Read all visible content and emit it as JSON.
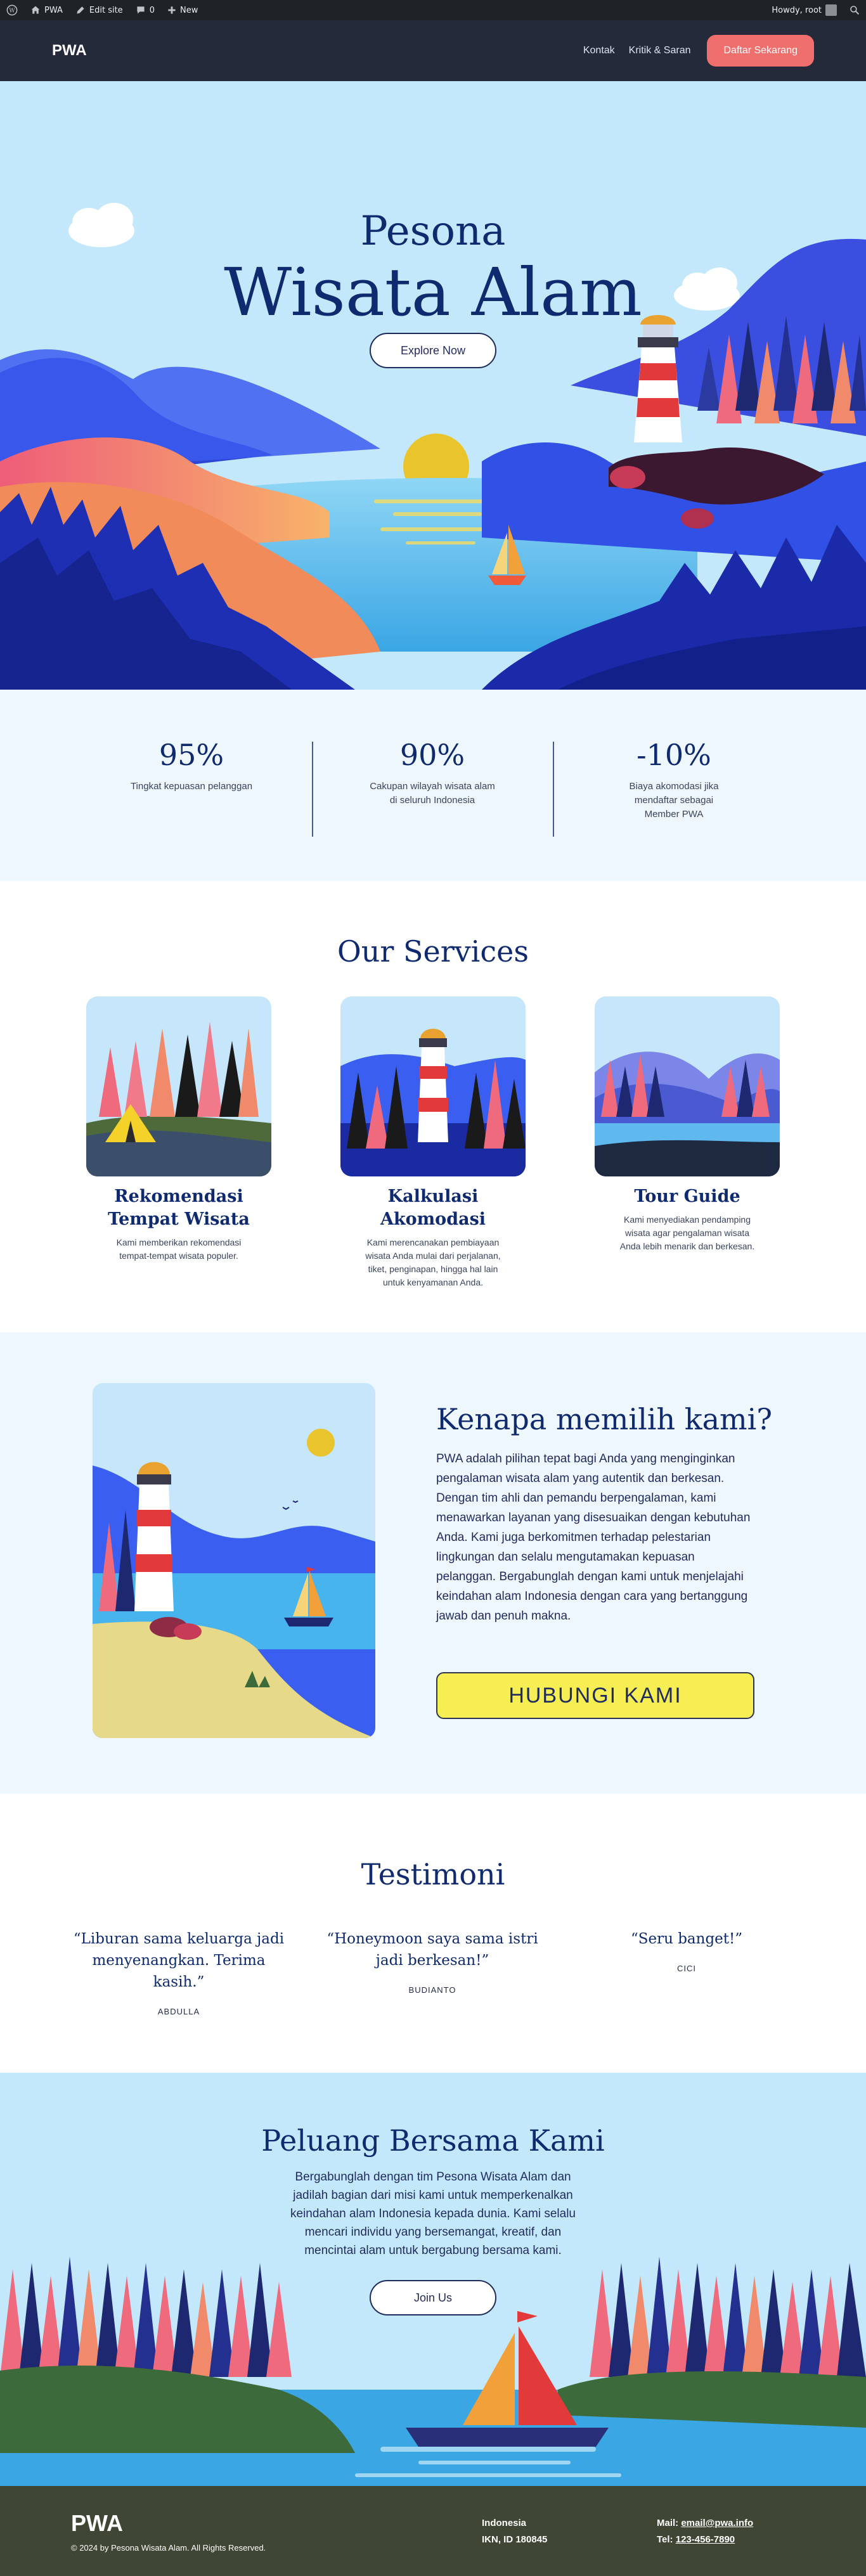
{
  "adminbar": {
    "site_name": "PWA",
    "edit_site": "Edit site",
    "comments_count": "0",
    "new_label": "New",
    "howdy": "Howdy, root"
  },
  "header": {
    "logo": "PWA",
    "nav": [
      "Kontak",
      "Kritik & Saran"
    ],
    "cta": "Daftar Sekarang"
  },
  "hero": {
    "kicker": "Pesona",
    "title": "Wisata Alam",
    "button": "Explore Now"
  },
  "stats": [
    {
      "value": "95%",
      "label": "Tingkat kepuasan pelanggan"
    },
    {
      "value": "90%",
      "label": "Cakupan wilayah wisata alam di seluruh Indonesia"
    },
    {
      "value": "-10%",
      "label": "Biaya akomodasi jika mendaftar sebagai Member PWA"
    }
  ],
  "services": {
    "title": "Our Services",
    "items": [
      {
        "title": "Rekomendasi Tempat Wisata",
        "desc": "Kami memberikan rekomendasi tempat-tempat wisata populer."
      },
      {
        "title": "Kalkulasi Akomodasi",
        "desc": "Kami merencanakan pembiayaan wisata Anda mulai dari perjalanan, tiket, penginapan, hingga hal lain untuk kenyamanan Anda."
      },
      {
        "title": "Tour Guide",
        "desc": "Kami menyediakan pendamping wisata agar pengalaman wisata Anda lebih menarik dan berkesan."
      }
    ]
  },
  "why": {
    "title": "Kenapa memilih kami?",
    "body": "PWA adalah pilihan tepat bagi Anda yang menginginkan pengalaman wisata alam yang autentik dan berkesan. Dengan tim ahli dan pemandu berpengalaman, kami menawarkan layanan yang disesuaikan dengan kebutuhan Anda. Kami juga berkomitmen terhadap pelestarian lingkungan dan selalu mengutamakan kepuasan pelanggan. Bergabunglah dengan kami untuk menjelajahi keindahan alam Indonesia dengan cara yang bertanggung jawab dan penuh makna.",
    "button": "HUBUNGI KAMI"
  },
  "testimoni": {
    "title": "Testimoni",
    "items": [
      {
        "quote": "“Liburan sama keluarga jadi menyenangkan. Terima kasih.”",
        "author": "ABDULLA"
      },
      {
        "quote": "“Honeymoon saya sama istri jadi berkesan!”",
        "author": "BUDIANTO"
      },
      {
        "quote": "“Seru banget!”",
        "author": "CICI"
      }
    ]
  },
  "peluang": {
    "title": "Peluang Bersama Kami",
    "body": "Bergabunglah dengan tim Pesona Wisata Alam dan jadilah bagian dari misi kami untuk memperkenalkan keindahan alam Indonesia kepada dunia. Kami selalu mencari individu yang bersemangat, kreatif, dan mencintai alam untuk bergabung bersama kami.",
    "button": "Join Us"
  },
  "footer": {
    "logo": "PWA",
    "copyright": "© 2024 by Pesona Wisata Alam. All Rights Reserved.",
    "address_line1": "Indonesia",
    "address_line2": "IKN, ID 180845",
    "mail_label": "Mail: ",
    "mail": "email@pwa.info",
    "tel_label": "Tel: ",
    "tel": "123-456-7890"
  },
  "colors": {
    "navy": "#0f2a6e",
    "header_bg": "#252a3b",
    "cta_coral": "#ef6f6c",
    "sky": "#c4e8fb",
    "button_yellow": "#f6ee52",
    "footer_bg": "#3f4634"
  },
  "icons": [
    "wordpress-icon",
    "home-icon",
    "pencil-icon",
    "comment-icon",
    "plus-icon",
    "search-icon"
  ]
}
